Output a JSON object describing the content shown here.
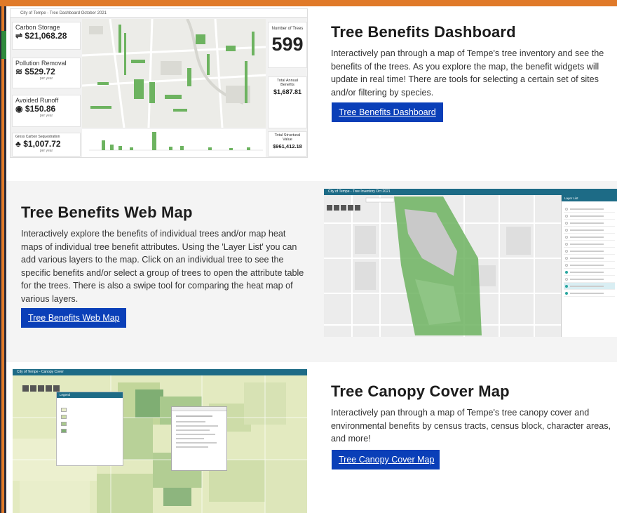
{
  "sections": [
    {
      "title": "Tree Benefits Dashboard",
      "description": "Interactively pan through a map of Tempe's tree inventory and see the benefits of the trees. As you explore the map, the benefit widgets will update in real time! There are tools for selecting a certain set of sites and/or filtering by species.",
      "button": "Tree Benefits Dashboard"
    },
    {
      "title": "Tree Benefits Web Map",
      "description": "Interactively explore the benefits of individual trees and/or map heat maps of individual tree benefit attributes. Using the 'Layer List' you can add various layers to the map. Click on an individual tree to see the specific benefits and/or select a group of trees to open the attribute table for the trees. There is also a swipe tool for comparing the heat map of various layers.",
      "button": "Tree Benefits Web Map"
    },
    {
      "title": "Tree Canopy Cover Map",
      "description": "Interactively pan through a map of Tempe's tree canopy cover and environmental benefits by census tracts, census block, character areas, and more!",
      "button": "Tree Canopy Cover Map"
    }
  ],
  "dashboard_thumb": {
    "header": "City of Tempe - Tree Dashboard October 2021",
    "stats": [
      {
        "label": "Carbon Storage",
        "value": "$21,068.28",
        "icon": "carbon-icon"
      },
      {
        "label": "Pollution Removal",
        "value": "$529.72",
        "sub": "per year",
        "icon": "wind-icon"
      },
      {
        "label": "Avoided Runoff",
        "value": "$150.86",
        "sub": "per year",
        "icon": "water-icon"
      },
      {
        "label": "Gross Carbon Sequestration",
        "value": "$1,007.72",
        "sub": "per year",
        "icon": "tree-icon"
      }
    ],
    "right": {
      "trees_label": "Number of Trees",
      "trees_value": "599",
      "annual_label": "Total Annual Benefits",
      "annual_value": "$1,687.81",
      "structural_label": "Total Structural Value",
      "structural_value": "$961,412.18"
    }
  },
  "webmap_thumb": {
    "header": "City of Tempe - Tree Inventory Oct 2021",
    "panel_title": "Layer List"
  },
  "canopy_thumb": {
    "header": "City of Tempe - Canopy Cover",
    "legend_title": "Legend"
  },
  "colors": {
    "button": "#0a3fb8",
    "accent_orange": "#e07a29",
    "tree_green": "#6db360",
    "header_teal": "#1d6b86"
  }
}
